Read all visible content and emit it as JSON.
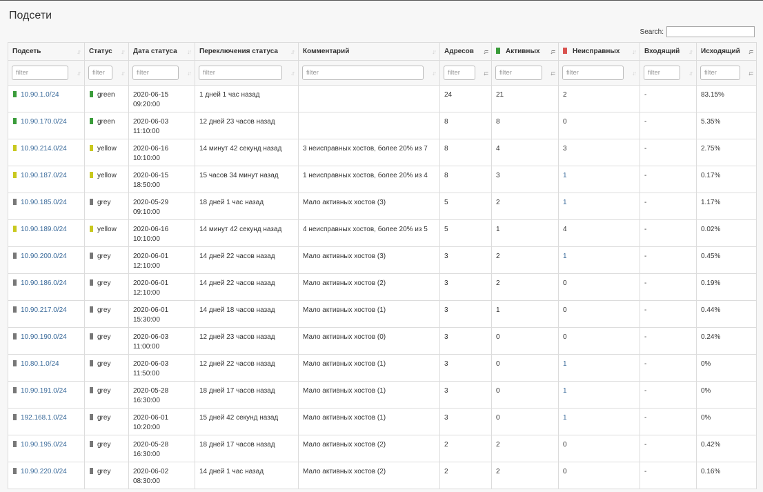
{
  "title": "Подсети",
  "search": {
    "label": "Search:",
    "value": ""
  },
  "colors": {
    "green": "#3a9c3a",
    "yellow": "#c8c81e",
    "grey": "#777777",
    "red": "#d9534f",
    "link": "#3a6a9a"
  },
  "columns": [
    {
      "label": "Подсеть",
      "sort": "both"
    },
    {
      "label": "Статус",
      "sort": "both"
    },
    {
      "label": "Дата статуса",
      "sort": "both"
    },
    {
      "label": "Переключения статуса",
      "sort": "both"
    },
    {
      "label": "Комментарий",
      "sort": "both"
    },
    {
      "label": "Адресов",
      "sort": "desc"
    },
    {
      "label": "Активных",
      "sort": "desc",
      "swatch": "green"
    },
    {
      "label": "Неисправных",
      "sort": "both",
      "swatch": "red"
    },
    {
      "label": "Входящий",
      "sort": "both"
    },
    {
      "label": "Исходящий",
      "sort": "desc"
    }
  ],
  "filter_placeholder": "filter",
  "rows": [
    {
      "subnet": "10.90.1.0/24",
      "status": "green",
      "date": "2020-06-15",
      "time": "09:20:00",
      "switch": "1 дней 1 час назад",
      "comment": "",
      "addresses": "24",
      "active": "21",
      "faulty": "2",
      "faulty_link": false,
      "incoming": "-",
      "outgoing": "83.15%"
    },
    {
      "subnet": "10.90.170.0/24",
      "status": "green",
      "date": "2020-06-03",
      "time": "11:10:00",
      "switch": "12 дней 23 часов назад",
      "comment": "",
      "addresses": "8",
      "active": "8",
      "faulty": "0",
      "faulty_link": false,
      "incoming": "-",
      "outgoing": "5.35%"
    },
    {
      "subnet": "10.90.214.0/24",
      "status": "yellow",
      "date": "2020-06-16",
      "time": "10:10:00",
      "switch": "14 минут 42 секунд назад",
      "comment": "3 неисправных хостов, более 20% из 7",
      "addresses": "8",
      "active": "4",
      "faulty": "3",
      "faulty_link": false,
      "incoming": "-",
      "outgoing": "2.75%"
    },
    {
      "subnet": "10.90.187.0/24",
      "status": "yellow",
      "date": "2020-06-15",
      "time": "18:50:00",
      "switch": "15 часов 34 минут назад",
      "comment": "1 неисправных хостов, более 20% из 4",
      "addresses": "8",
      "active": "3",
      "faulty": "1",
      "faulty_link": true,
      "incoming": "-",
      "outgoing": "0.17%"
    },
    {
      "subnet": "10.90.185.0/24",
      "status": "grey",
      "date": "2020-05-29",
      "time": "09:10:00",
      "switch": "18 дней 1 час назад",
      "comment": "Мало активных хостов (3)",
      "addresses": "5",
      "active": "2",
      "faulty": "1",
      "faulty_link": true,
      "incoming": "-",
      "outgoing": "1.17%"
    },
    {
      "subnet": "10.90.189.0/24",
      "status": "yellow",
      "date": "2020-06-16",
      "time": "10:10:00",
      "switch": "14 минут 42 секунд назад",
      "comment": "4 неисправных хостов, более 20% из 5",
      "addresses": "5",
      "active": "1",
      "faulty": "4",
      "faulty_link": false,
      "incoming": "-",
      "outgoing": "0.02%"
    },
    {
      "subnet": "10.90.200.0/24",
      "status": "grey",
      "date": "2020-06-01",
      "time": "12:10:00",
      "switch": "14 дней 22 часов назад",
      "comment": "Мало активных хостов (3)",
      "addresses": "3",
      "active": "2",
      "faulty": "1",
      "faulty_link": true,
      "incoming": "-",
      "outgoing": "0.45%"
    },
    {
      "subnet": "10.90.186.0/24",
      "status": "grey",
      "date": "2020-06-01",
      "time": "12:10:00",
      "switch": "14 дней 22 часов назад",
      "comment": "Мало активных хостов (2)",
      "addresses": "3",
      "active": "2",
      "faulty": "0",
      "faulty_link": false,
      "incoming": "-",
      "outgoing": "0.19%"
    },
    {
      "subnet": "10.90.217.0/24",
      "status": "grey",
      "date": "2020-06-01",
      "time": "15:30:00",
      "switch": "14 дней 18 часов назад",
      "comment": "Мало активных хостов (1)",
      "addresses": "3",
      "active": "1",
      "faulty": "0",
      "faulty_link": false,
      "incoming": "-",
      "outgoing": "0.44%"
    },
    {
      "subnet": "10.90.190.0/24",
      "status": "grey",
      "date": "2020-06-03",
      "time": "11:00:00",
      "switch": "12 дней 23 часов назад",
      "comment": "Мало активных хостов (0)",
      "addresses": "3",
      "active": "0",
      "faulty": "0",
      "faulty_link": false,
      "incoming": "-",
      "outgoing": "0.24%"
    },
    {
      "subnet": "10.80.1.0/24",
      "status": "grey",
      "date": "2020-06-03",
      "time": "11:50:00",
      "switch": "12 дней 22 часов назад",
      "comment": "Мало активных хостов (1)",
      "addresses": "3",
      "active": "0",
      "faulty": "1",
      "faulty_link": true,
      "incoming": "-",
      "outgoing": "0%"
    },
    {
      "subnet": "10.90.191.0/24",
      "status": "grey",
      "date": "2020-05-28",
      "time": "16:30:00",
      "switch": "18 дней 17 часов назад",
      "comment": "Мало активных хостов (1)",
      "addresses": "3",
      "active": "0",
      "faulty": "1",
      "faulty_link": true,
      "incoming": "-",
      "outgoing": "0%"
    },
    {
      "subnet": "192.168.1.0/24",
      "status": "grey",
      "date": "2020-06-01",
      "time": "10:20:00",
      "switch": "15 дней 42 секунд назад",
      "comment": "Мало активных хостов (1)",
      "addresses": "3",
      "active": "0",
      "faulty": "1",
      "faulty_link": true,
      "incoming": "-",
      "outgoing": "0%"
    },
    {
      "subnet": "10.90.195.0/24",
      "status": "grey",
      "date": "2020-05-28",
      "time": "16:30:00",
      "switch": "18 дней 17 часов назад",
      "comment": "Мало активных хостов (2)",
      "addresses": "2",
      "active": "2",
      "faulty": "0",
      "faulty_link": false,
      "incoming": "-",
      "outgoing": "0.42%"
    },
    {
      "subnet": "10.90.220.0/24",
      "status": "grey",
      "date": "2020-06-02",
      "time": "08:30:00",
      "switch": "14 дней 1 час назад",
      "comment": "Мало активных хостов (2)",
      "addresses": "2",
      "active": "2",
      "faulty": "0",
      "faulty_link": false,
      "incoming": "-",
      "outgoing": "0.16%"
    }
  ]
}
